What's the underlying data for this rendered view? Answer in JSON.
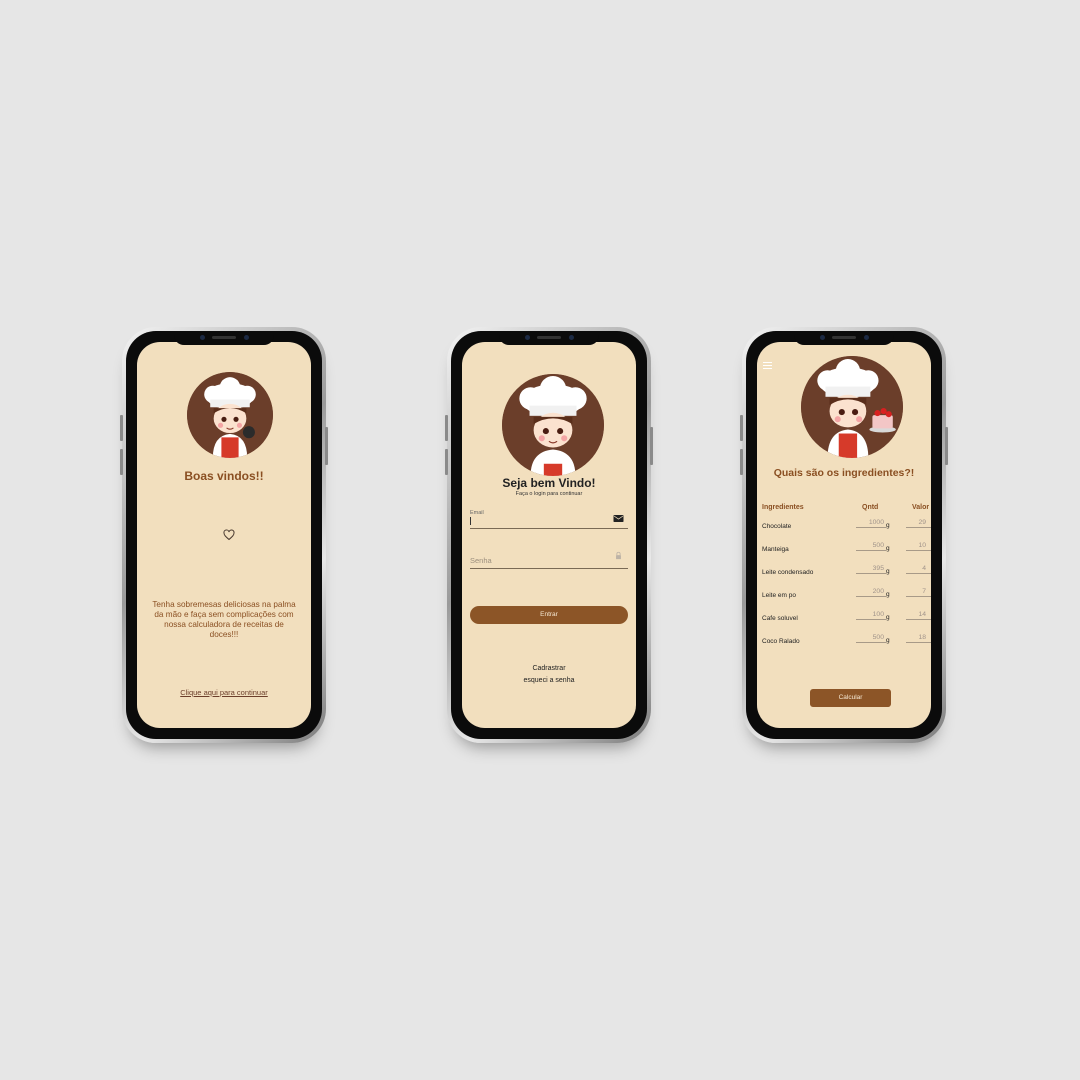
{
  "screen1": {
    "title": "Boas vindos!!",
    "description": "Tenha sobremesas deliciosas na palma da mão e faça sem complicações com nossa calculadora de receitas de doces!!!",
    "continue_link": "Clique aqui para continuar",
    "icons": [
      "chef-avatar-icon",
      "heart-icon"
    ]
  },
  "screen2": {
    "title": "Seja bem Vindo!",
    "subtitle": "Faça o login para continuar",
    "email_label": "Email",
    "password_placeholder": "Senha",
    "login_button": "Entrar",
    "register_link": "Cadrastrar",
    "forgot_link": "esqueci a senha",
    "icons": [
      "mail-icon",
      "lock-icon"
    ]
  },
  "screen3": {
    "title": "Quais são os ingredientes?!",
    "headers": {
      "ingredient": "Ingredientes",
      "qty": "Qntd",
      "value": "Valor"
    },
    "unit": "g",
    "ingredients": [
      {
        "name": "Chocolate",
        "qty": "1000",
        "value": "29"
      },
      {
        "name": "Manteiga",
        "qty": "500",
        "value": "10"
      },
      {
        "name": "Leite condensado",
        "qty": "395",
        "value": "4"
      },
      {
        "name": "Leite em po",
        "qty": "200",
        "value": "7"
      },
      {
        "name": "Cafe soluvel",
        "qty": "100",
        "value": "14"
      },
      {
        "name": "Coco Ralado",
        "qty": "500",
        "value": "18"
      }
    ],
    "calc_button": "Calcular",
    "icons": [
      "menu-icon"
    ]
  },
  "colors": {
    "background": "#e6e6e6",
    "screen": "#f2dfbe",
    "accent": "#8c5527",
    "title": "#8a4f22"
  }
}
